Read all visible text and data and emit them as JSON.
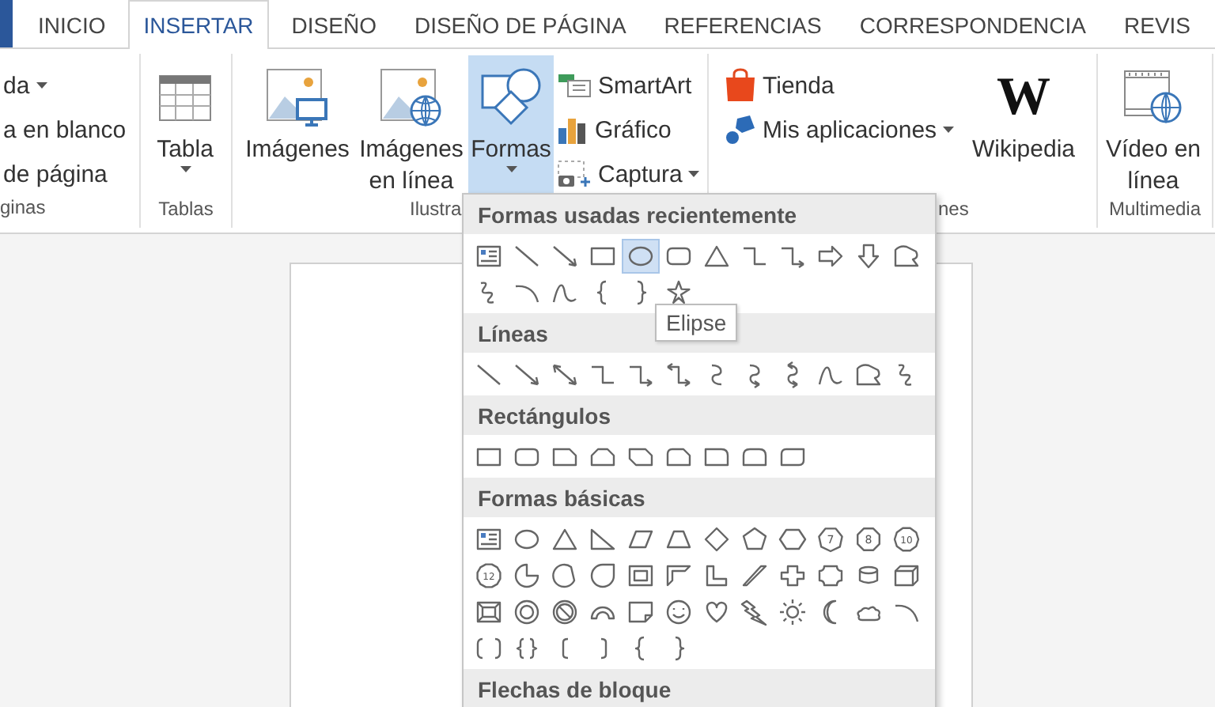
{
  "tabs": [
    {
      "label": "INICIO",
      "selected": false
    },
    {
      "label": "INSERTAR",
      "selected": true
    },
    {
      "label": "DISEÑO",
      "selected": false
    },
    {
      "label": "DISEÑO DE PÁGINA",
      "selected": false
    },
    {
      "label": "REFERENCIAS",
      "selected": false
    },
    {
      "label": "CORRESPONDENCIA",
      "selected": false
    },
    {
      "label": "REVIS",
      "selected": false
    }
  ],
  "ribbon_groups": [
    {
      "label": "ginas",
      "items": [
        {
          "kind": "small",
          "label": "da",
          "dropdown": true,
          "pressed": false
        },
        {
          "kind": "small",
          "label": "a en blanco",
          "dropdown": false,
          "pressed": false
        },
        {
          "kind": "small",
          "label": "de página",
          "dropdown": false,
          "pressed": false
        }
      ]
    },
    {
      "label": "Tablas",
      "items": [
        {
          "kind": "large",
          "label": "Tabla",
          "dropdown": true,
          "pressed": false
        }
      ]
    },
    {
      "label": "Ilustra",
      "items": [
        {
          "kind": "large",
          "label": "Imágenes",
          "dropdown": false,
          "pressed": false
        },
        {
          "kind": "large",
          "label": "Imágenes en línea",
          "dropdown": false,
          "pressed": false
        },
        {
          "kind": "large",
          "label": "Formas",
          "dropdown": true,
          "pressed": true
        },
        {
          "kind": "small",
          "label": "SmartArt",
          "dropdown": false,
          "pressed": false
        },
        {
          "kind": "small",
          "label": "Gráfico",
          "dropdown": false,
          "pressed": false
        },
        {
          "kind": "small",
          "label": "Captura",
          "dropdown": true,
          "pressed": false
        }
      ]
    },
    {
      "label": "nes",
      "items": [
        {
          "kind": "small",
          "label": "Tienda",
          "dropdown": false,
          "pressed": false
        },
        {
          "kind": "small",
          "label": "Mis aplicaciones",
          "dropdown": true,
          "pressed": false
        },
        {
          "kind": "large",
          "label": "Wikipedia",
          "logo": "W",
          "dropdown": false,
          "pressed": false
        }
      ]
    },
    {
      "label": "Multimedia",
      "items": [
        {
          "kind": "large",
          "label": "Vídeo en línea",
          "dropdown": false,
          "pressed": false
        }
      ]
    }
  ],
  "shapes_menu": {
    "sections": [
      {
        "title": "Formas usadas recientemente",
        "shapes": [
          {
            "kind": "textbox",
            "selected": false
          },
          {
            "kind": "line",
            "selected": false
          },
          {
            "kind": "arrow-line",
            "selected": false
          },
          {
            "kind": "rect",
            "selected": false
          },
          {
            "kind": "ellipse",
            "selected": true
          },
          {
            "kind": "rounded-rect",
            "selected": false
          },
          {
            "kind": "triangle",
            "selected": false
          },
          {
            "kind": "elbow",
            "selected": false
          },
          {
            "kind": "elbow-arrow",
            "selected": false
          },
          {
            "kind": "right-arrow",
            "selected": false
          },
          {
            "kind": "down-arrow",
            "selected": false
          },
          {
            "kind": "freeform",
            "selected": false
          },
          {
            "kind": "scribble",
            "selected": false
          },
          {
            "kind": "arc",
            "selected": false
          },
          {
            "kind": "curve",
            "selected": false
          },
          {
            "kind": "left-brace",
            "selected": false
          },
          {
            "kind": "right-brace",
            "selected": false
          },
          {
            "kind": "star",
            "selected": false
          }
        ]
      },
      {
        "title": "Líneas",
        "shapes": [
          {
            "kind": "line",
            "selected": false
          },
          {
            "kind": "arrow-line",
            "selected": false
          },
          {
            "kind": "double-arrow-line",
            "selected": false
          },
          {
            "kind": "elbow",
            "selected": false
          },
          {
            "kind": "elbow-arrow",
            "selected": false
          },
          {
            "kind": "elbow-double-arrow",
            "selected": false
          },
          {
            "kind": "curved-connector",
            "selected": false
          },
          {
            "kind": "curved-arrow",
            "selected": false
          },
          {
            "kind": "curved-double-arrow",
            "selected": false
          },
          {
            "kind": "curve",
            "selected": false
          },
          {
            "kind": "freeform",
            "selected": false
          },
          {
            "kind": "scribble",
            "selected": false
          }
        ]
      },
      {
        "title": "Rectángulos",
        "shapes": [
          {
            "kind": "rect",
            "selected": false
          },
          {
            "kind": "rounded-rect",
            "selected": false
          },
          {
            "kind": "snip-rect",
            "selected": false
          },
          {
            "kind": "snip2-rect",
            "selected": false
          },
          {
            "kind": "snip-diag-rect",
            "selected": false
          },
          {
            "kind": "snip-round-rect",
            "selected": false
          },
          {
            "kind": "round1-rect",
            "selected": false
          },
          {
            "kind": "round2-rect",
            "selected": false
          },
          {
            "kind": "round-diag-rect",
            "selected": false
          }
        ]
      },
      {
        "title": "Formas básicas",
        "shapes": [
          {
            "kind": "textbox",
            "selected": false
          },
          {
            "kind": "ellipse",
            "selected": false
          },
          {
            "kind": "triangle",
            "selected": false
          },
          {
            "kind": "right-triangle",
            "selected": false
          },
          {
            "kind": "parallelogram",
            "selected": false
          },
          {
            "kind": "trapezoid",
            "selected": false
          },
          {
            "kind": "diamond",
            "selected": false
          },
          {
            "kind": "pentagon",
            "selected": false
          },
          {
            "kind": "hexagon",
            "selected": false
          },
          {
            "kind": "heptagon",
            "label": "7",
            "selected": false
          },
          {
            "kind": "octagon",
            "label": "8",
            "selected": false
          },
          {
            "kind": "decagon",
            "label": "10",
            "selected": false
          },
          {
            "kind": "dodecagon",
            "label": "12",
            "selected": false
          },
          {
            "kind": "pie",
            "selected": false
          },
          {
            "kind": "chord",
            "selected": false
          },
          {
            "kind": "teardrop",
            "selected": false
          },
          {
            "kind": "frame",
            "selected": false
          },
          {
            "kind": "half-frame",
            "selected": false
          },
          {
            "kind": "l-shape",
            "selected": false
          },
          {
            "kind": "diagonal-stripe",
            "selected": false
          },
          {
            "kind": "cross",
            "selected": false
          },
          {
            "kind": "plaque",
            "selected": false
          },
          {
            "kind": "can",
            "selected": false
          },
          {
            "kind": "cube",
            "selected": false
          },
          {
            "kind": "bevel",
            "selected": false
          },
          {
            "kind": "donut",
            "selected": false
          },
          {
            "kind": "no-symbol",
            "selected": false
          },
          {
            "kind": "block-arc",
            "selected": false
          },
          {
            "kind": "folded-corner",
            "selected": false
          },
          {
            "kind": "smiley",
            "selected": false
          },
          {
            "kind": "heart",
            "selected": false
          },
          {
            "kind": "lightning",
            "selected": false
          },
          {
            "kind": "sun",
            "selected": false
          },
          {
            "kind": "moon",
            "selected": false
          },
          {
            "kind": "cloud",
            "selected": false
          },
          {
            "kind": "arc",
            "selected": false
          },
          {
            "kind": "double-bracket",
            "selected": false
          },
          {
            "kind": "double-brace",
            "selected": false
          },
          {
            "kind": "left-bracket",
            "selected": false
          },
          {
            "kind": "right-bracket",
            "selected": false
          },
          {
            "kind": "left-brace",
            "selected": false
          },
          {
            "kind": "right-brace",
            "selected": false
          }
        ]
      },
      {
        "title": "Flechas de bloque"
      }
    ]
  },
  "tooltip": "Elipse"
}
